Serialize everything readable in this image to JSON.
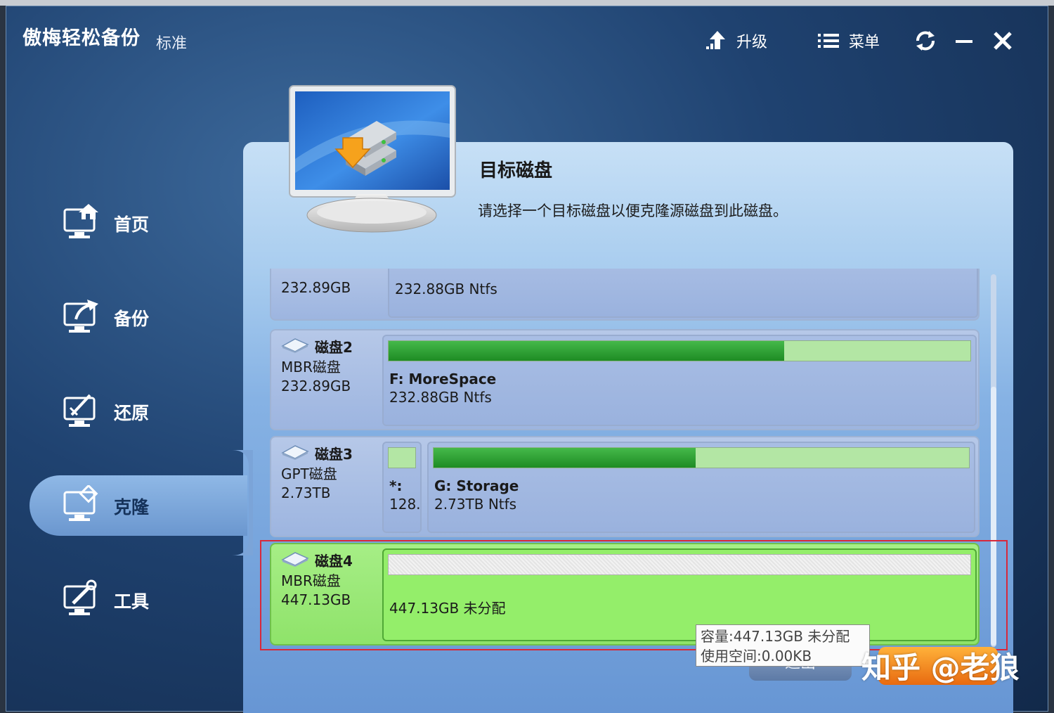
{
  "app": {
    "title": "傲梅轻松备份",
    "edition": "标准"
  },
  "toolbar": {
    "upgrade_label": "升级",
    "menu_label": "菜单"
  },
  "nav": {
    "items": [
      {
        "label": "首页",
        "icon": "home-monitor-icon"
      },
      {
        "label": "备份",
        "icon": "backup-monitor-icon"
      },
      {
        "label": "还原",
        "icon": "restore-monitor-icon"
      },
      {
        "label": "克隆",
        "icon": "clone-monitor-icon",
        "active": true
      },
      {
        "label": "工具",
        "icon": "tools-monitor-icon"
      }
    ]
  },
  "panel": {
    "title": "目标磁盘",
    "description": "请选择一个目标磁盘以便克隆源磁盘到此磁盘。"
  },
  "disks": [
    {
      "size": "232.89GB",
      "partition": "232.88GB Ntfs"
    },
    {
      "name": "磁盘2",
      "type": "MBR磁盘",
      "size": "232.89GB",
      "partition": {
        "label": "F: MoreSpace",
        "detail": "232.88GB Ntfs",
        "used_fraction": 0.68
      }
    },
    {
      "name": "磁盘3",
      "type": "GPT磁盘",
      "size": "2.73TB",
      "partitions": [
        {
          "label": "*:",
          "detail": "128."
        },
        {
          "label": "G: Storage",
          "detail": "2.73TB Ntfs",
          "used_fraction": 0.49
        }
      ]
    },
    {
      "name": "磁盘4",
      "type": "MBR磁盘",
      "size": "447.13GB",
      "partition": {
        "detail": "447.13GB 未分配"
      },
      "selected": true
    }
  ],
  "tooltip": {
    "line1": "容量:447.13GB 未分配",
    "line2": "使用空间:0.00KB"
  },
  "buttons": {
    "back": "退出"
  },
  "watermark": "知乎 @老狼",
  "colors": {
    "accent_green": "#2aa52f",
    "selection_red": "#d8283a",
    "panel_blue": "#86b2e4"
  }
}
